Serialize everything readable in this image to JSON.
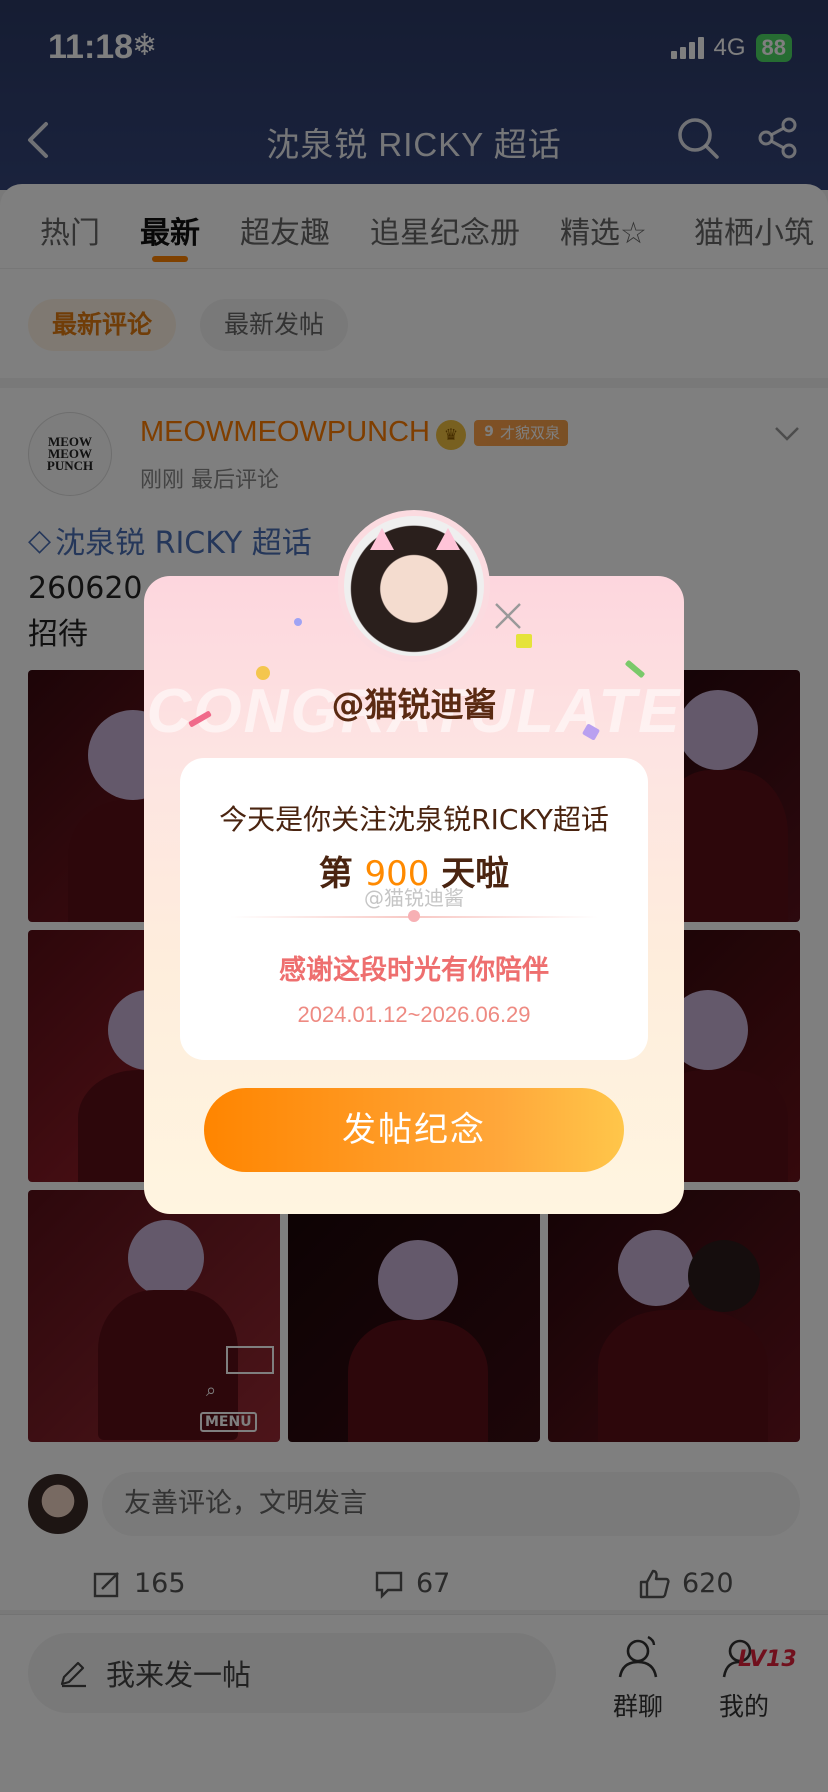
{
  "status_bar": {
    "time": "11:18",
    "weather_icon": "snowflake-icon",
    "network": "4G",
    "battery": "88"
  },
  "header": {
    "title": "沈泉锐 RICKY 超话"
  },
  "tabs": [
    {
      "label": "热门",
      "active": false
    },
    {
      "label": "最新",
      "active": true
    },
    {
      "label": "超友趣",
      "active": false
    },
    {
      "label": "追星纪念册",
      "active": false
    },
    {
      "label": "精选",
      "active": false
    },
    {
      "label": "猫栖小筑",
      "active": false
    }
  ],
  "filters": {
    "latest_comments": "最新评论",
    "latest_posts": "最新发帖"
  },
  "post": {
    "avatar_logo": "MEOW MEOW PUNCH",
    "username": "MEOWMEOWPUNCH",
    "badge_level": "9",
    "badge": "才貌双泉",
    "time": "刚刚 最后评论",
    "topic": "沈泉锐 RICKY 超话",
    "text_line1": "260620 ...",
    "text_line2": "招待",
    "photo_menu_label": "MENU",
    "comment_placeholder": "友善评论，文明发言",
    "reposts": "165",
    "comments": "67",
    "likes": "620"
  },
  "bottom_bar": {
    "compose": "我来发一帖",
    "group_chat": "群聊",
    "mine": "我的",
    "level": "LV13"
  },
  "modal": {
    "bg_text": "CONGRATULATE",
    "name": "@猫锐迪酱",
    "line1": "今天是你关注沈泉锐RICKY超话",
    "line2_prefix": "第 ",
    "days": "900",
    "line2_suffix": " 天啦",
    "watermark": "@猫锐迪酱",
    "thanks": "感谢这段时光有你陪伴",
    "date_range": "2024.01.12~2026.06.29",
    "button": "发帖纪念"
  },
  "colors": {
    "accent": "#ff8200",
    "header_bg": "#2c3a66",
    "topic_link": "#4a6fb5"
  }
}
